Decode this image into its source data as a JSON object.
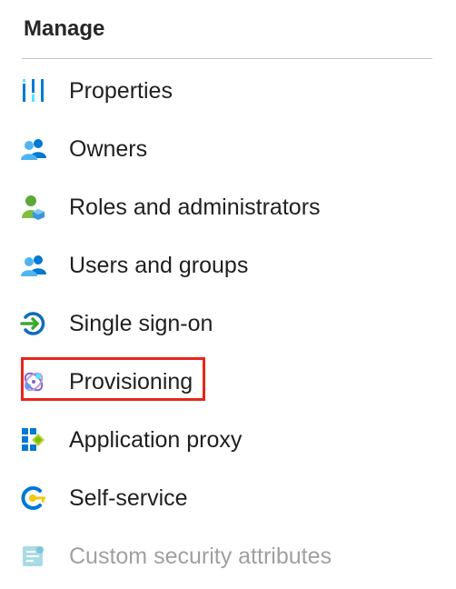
{
  "section": {
    "title": "Manage"
  },
  "items": [
    {
      "label": "Properties",
      "icon": "properties-icon"
    },
    {
      "label": "Owners",
      "icon": "owners-icon"
    },
    {
      "label": "Roles and administrators",
      "icon": "roles-icon"
    },
    {
      "label": "Users and groups",
      "icon": "users-groups-icon"
    },
    {
      "label": "Single sign-on",
      "icon": "single-sign-on-icon"
    },
    {
      "label": "Provisioning",
      "icon": "provisioning-icon",
      "highlighted": true
    },
    {
      "label": "Application proxy",
      "icon": "application-proxy-icon"
    },
    {
      "label": "Self-service",
      "icon": "self-service-icon"
    },
    {
      "label": "Custom security attributes",
      "icon": "custom-security-attributes-icon",
      "disabled": true
    }
  ],
  "colors": {
    "highlight": "#e8261b",
    "disabled_text": "#a0a0a0",
    "divider": "#c8c8c8"
  }
}
